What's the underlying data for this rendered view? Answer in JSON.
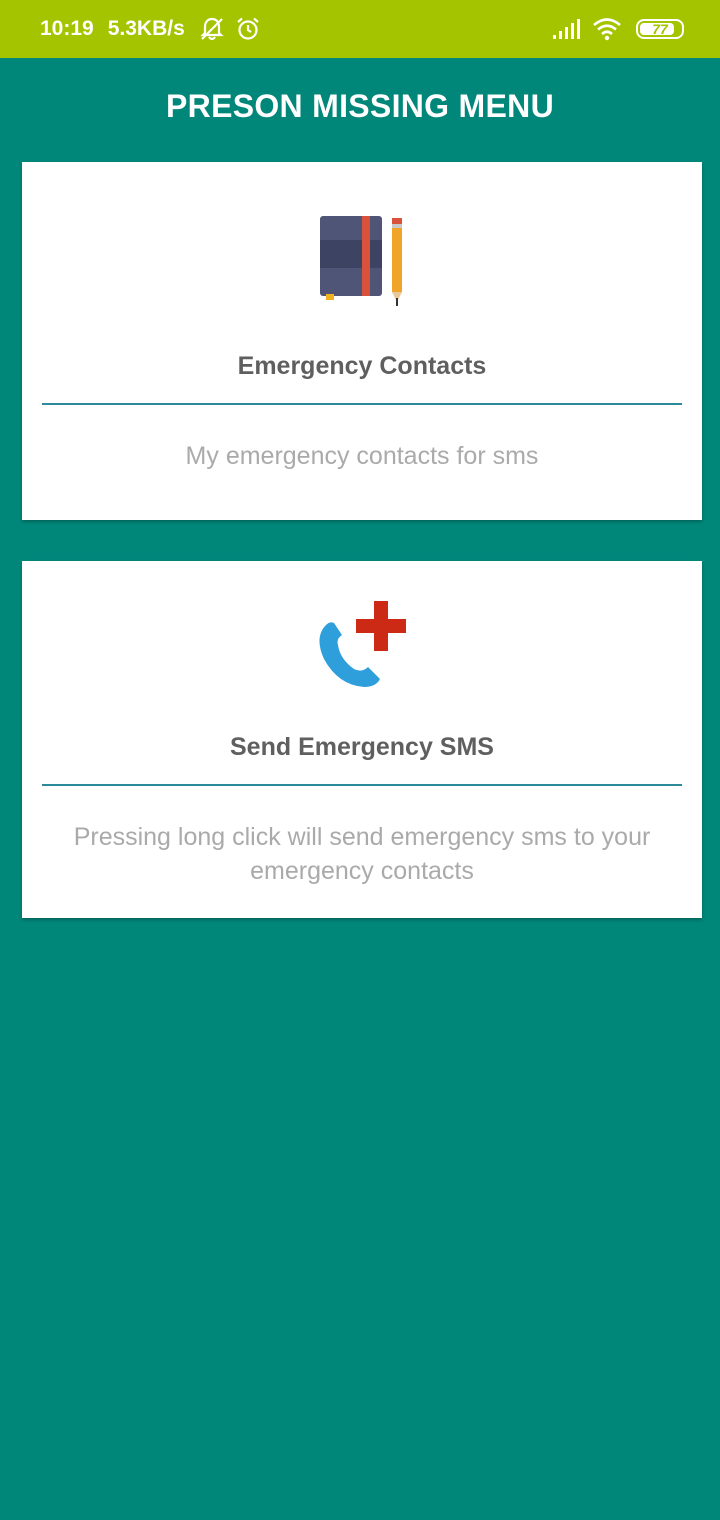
{
  "status_bar": {
    "time": "10:19",
    "net_speed": "5.3KB/s",
    "battery_level": "77",
    "icons": [
      "notifications-off-icon",
      "alarm-icon",
      "signal-icon",
      "wifi-icon",
      "battery-icon"
    ],
    "background_color": "#a5c400"
  },
  "app": {
    "title": "PRESON MISSING MENU",
    "background_color": "#00877a"
  },
  "cards": [
    {
      "title": "Emergency Contacts",
      "description": "My emergency contacts for sms",
      "icon": "notebook-pencil-icon"
    },
    {
      "title": "Send Emergency SMS",
      "description": "Pressing long click will send emergency sms to your emergency contacts",
      "icon": "emergency-call-icon"
    }
  ],
  "colors": {
    "divider": "#2d8a9a",
    "title_text": "#5f5f5f",
    "description_text": "#aaaaaa"
  }
}
